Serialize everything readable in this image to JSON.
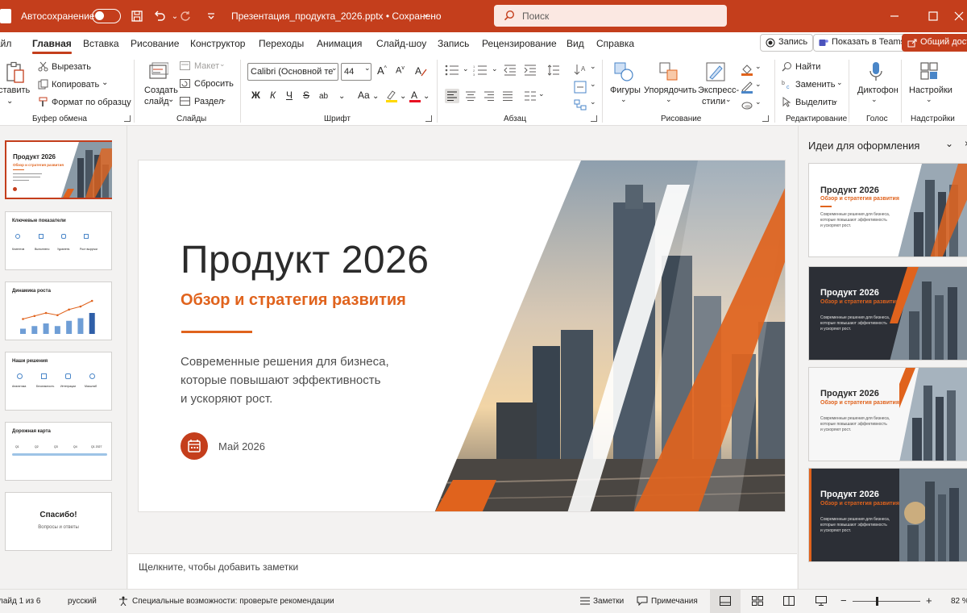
{
  "titlebar": {
    "autosave_label": "Автосохранение",
    "document_title": "Презентация_продукта_2026.pptx • Сохранено",
    "search_placeholder": "Поиск"
  },
  "menu": {
    "tabs": [
      "айл",
      "Главная",
      "Вставка",
      "Рисование",
      "Конструктор",
      "Переходы",
      "Анимация",
      "Слайд-шоу",
      "Запись",
      "Рецензирование",
      "Вид",
      "Справка"
    ],
    "active_tab": "Главная",
    "record_label": "Запись",
    "teams_label": "Показать в Teams",
    "share_label": "Общий доступ"
  },
  "ribbon": {
    "clipboard": {
      "paste": "ставить",
      "cut": "Вырезать",
      "copy": "Копировать",
      "format_painter": "Формат по образцу",
      "group": "Буфер обмена"
    },
    "slides": {
      "new_slide_line1": "Создать",
      "new_slide_line2": "слайд",
      "layout": "Макет",
      "reset": "Сбросить",
      "section": "Раздел",
      "group": "Слайды"
    },
    "font": {
      "name": "Calibri (Основной те",
      "size": "44",
      "bold": "Ж",
      "italic": "К",
      "underline": "Ч",
      "strike": "S",
      "spacing": "ab",
      "case": "Aa",
      "group": "Шрифт"
    },
    "paragraph": {
      "group": "Абзац"
    },
    "drawing": {
      "shapes": "Фигуры",
      "arrange": "Упорядочить",
      "styles_line1": "Экспресс-",
      "styles_line2": "стили",
      "group": "Рисование"
    },
    "editing": {
      "find": "Найти",
      "replace": "Заменить",
      "select": "Выделить",
      "group": "Редактирование"
    },
    "voice": {
      "dictate": "Диктофон",
      "group": "Голос"
    },
    "addins": {
      "settings": "Настройки",
      "group": "Надстройки"
    }
  },
  "thumbnails": [
    {
      "title": "Продукт 2026",
      "subtitle": "Обзор и стратегия развития"
    },
    {
      "title": "Ключевые показатели",
      "labels": [
        "Клиентов",
        "Выполнено",
        "Удовлетв.",
        "Рост выручки"
      ]
    },
    {
      "title": "Динамика роста",
      "values": [
        2,
        3,
        4,
        3,
        5,
        6,
        8
      ]
    },
    {
      "title": "Наши решения",
      "labels": [
        "Аналитика",
        "Безопасность",
        "Интеграции",
        "Масштаб"
      ]
    },
    {
      "title": "Дорожная карта",
      "labels": [
        "Q1",
        "Q2",
        "Q3",
        "Q4",
        "Q1 2027"
      ]
    },
    {
      "title": "Спасибо!",
      "subtitle": "Вопросы и ответы"
    }
  ],
  "slide": {
    "title": "Продукт 2026",
    "subtitle": "Обзор и стратегия развития",
    "description_lines": [
      "Современные решения для бизнеса,",
      "которые повышают эффективность",
      "и ускоряют рост."
    ],
    "date": "Май 2026",
    "accent": "#e0631d"
  },
  "notes_placeholder": "Щелкните, чтобы добавить заметки",
  "designer": {
    "title": "Идеи для оформления",
    "cards": [
      {
        "title": "Продукт 2026",
        "subtitle": "Обзор и стратегия развития",
        "desc": "Современные решения для бизнеса,\nкоторые повышают эффективность\nи ускоряют рост.",
        "theme": "light"
      },
      {
        "title": "Продукт 2026",
        "subtitle": "Обзор и стратегия развития",
        "desc": "Современные решения для бизнеса,\nкоторые повышают эффективность\nи ускоряют рост.",
        "theme": "dark"
      },
      {
        "title": "Продукт 2026",
        "subtitle": "Обзор и стратегия развития",
        "desc": "Современные решения для бизнеса,\nкоторые повышают эффективность\nи ускоряют рост.",
        "theme": "light"
      },
      {
        "title": "Продукт 2026",
        "subtitle": "Обзор и стратегия развития",
        "desc": "Современные решения для бизнеса,\nкоторые повышают эффективность\nи ускоряют рост.",
        "theme": "dark"
      }
    ]
  },
  "statusbar": {
    "slide_counter": "лайд 1 из 6",
    "language": "русский",
    "accessibility": "Специальные возможности: проверьте рекомендации",
    "notes": "Заметки",
    "comments": "Примечания",
    "zoom": "82 %"
  },
  "colors": {
    "brand": "#c43e1c",
    "accent": "#e0631d",
    "dark_theme": "#2c2f36"
  }
}
